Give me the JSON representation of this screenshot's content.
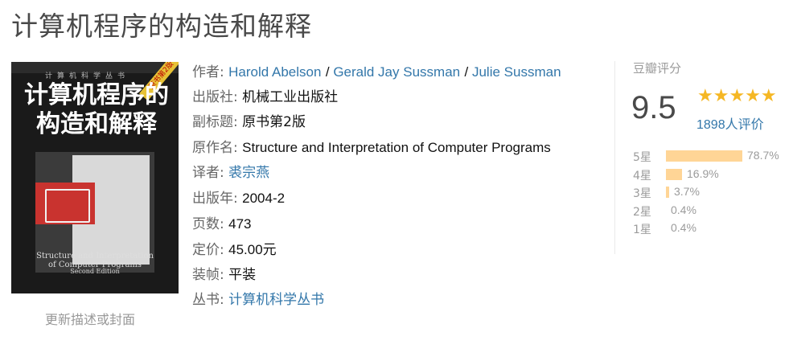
{
  "page": {
    "title": "计算机程序的构造和解释"
  },
  "cover": {
    "series": "计算机科学丛书",
    "badge": "原书第2版",
    "title_line1": "计算机程序的",
    "title_line2": "构造和解释",
    "en_title_line1": "Structure and Interpretation",
    "en_title_line2": "of Computer Programs",
    "edition": "Second Edition",
    "update_link": "更新描述或封面"
  },
  "info": {
    "author_label": "作者:",
    "authors": [
      "Harold Abelson",
      "Gerald Jay Sussman",
      "Julie Sussman"
    ],
    "author_sep": "/",
    "publisher_label": "出版社:",
    "publisher": "机械工业出版社",
    "subtitle_label": "副标题:",
    "subtitle": "原书第2版",
    "original_title_label": "原作名:",
    "original_title": "Structure and Interpretation of Computer Programs",
    "translator_label": "译者:",
    "translator": "裘宗燕",
    "pub_year_label": "出版年:",
    "pub_year": "2004-2",
    "pages_label": "页数:",
    "pages": "473",
    "price_label": "定价:",
    "price": "45.00元",
    "binding_label": "装帧:",
    "binding": "平装",
    "series_label": "丛书:",
    "series": "计算机科学丛书"
  },
  "rating": {
    "label": "豆瓣评分",
    "score": "9.5",
    "stars": "★★★★★",
    "votes_count": "1898",
    "votes_unit": "人评价",
    "star_color": "#f5b724",
    "bar_color": "#ffd596",
    "distribution": [
      {
        "label": "5星",
        "percent": "78.7%",
        "value": 78.7
      },
      {
        "label": "4星",
        "percent": "16.9%",
        "value": 16.9
      },
      {
        "label": "3星",
        "percent": "3.7%",
        "value": 3.7
      },
      {
        "label": "2星",
        "percent": "0.4%",
        "value": 0.4
      },
      {
        "label": "1星",
        "percent": "0.4%",
        "value": 0.4
      }
    ]
  }
}
